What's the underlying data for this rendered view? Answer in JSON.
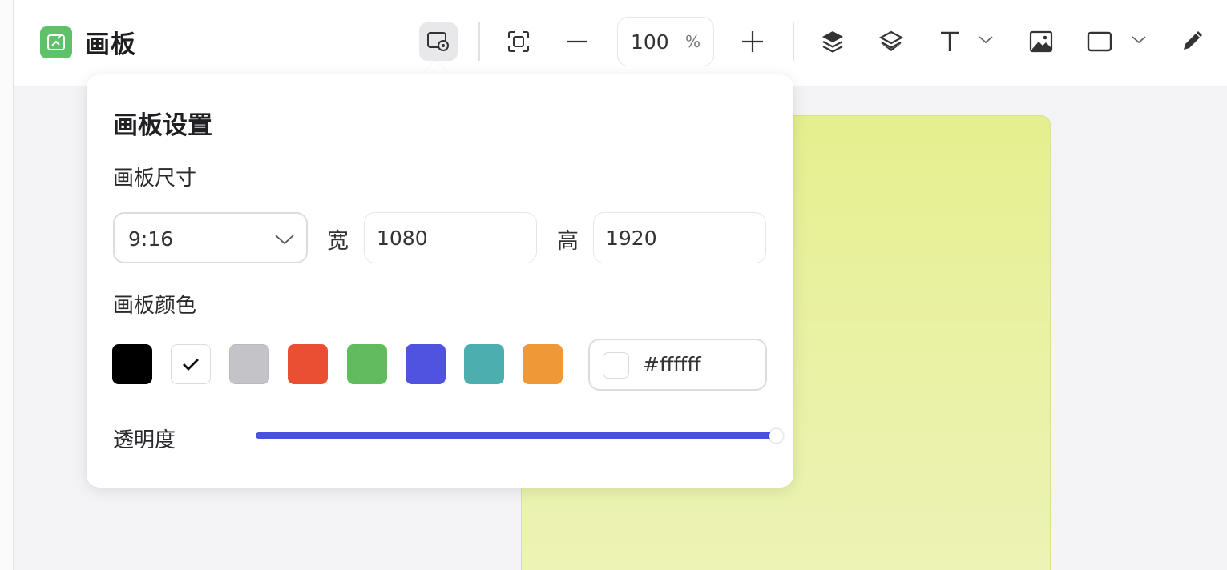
{
  "app": {
    "title": "画板",
    "logo_color": "#5fc16a",
    "logo_icon": "whiteboard-icon"
  },
  "toolbar": {
    "tools": [
      {
        "name": "artboard-settings",
        "icon": "artboard-settings-icon",
        "active": true
      },
      {
        "name": "fit-screen",
        "icon": "fit-screen-icon"
      },
      {
        "name": "zoom-out",
        "icon": "minus-icon"
      },
      {
        "name": "zoom-in",
        "icon": "plus-icon"
      },
      {
        "name": "bring-forward",
        "icon": "layer-up-icon"
      },
      {
        "name": "send-backward",
        "icon": "layer-down-icon"
      },
      {
        "name": "text",
        "icon": "text-icon",
        "has_dropdown": true
      },
      {
        "name": "image",
        "icon": "image-icon"
      },
      {
        "name": "shape",
        "icon": "rectangle-icon",
        "has_dropdown": true
      },
      {
        "name": "pen",
        "icon": "pen-icon"
      }
    ],
    "zoom": {
      "value": "100",
      "unit": "%"
    }
  },
  "canvas": {
    "artboard_color": "#e8f09a"
  },
  "popover": {
    "title": "画板设置",
    "size_section": {
      "label": "画板尺寸",
      "ratio_value": "9:16",
      "width_label": "宽",
      "width_value": "1080",
      "height_label": "高",
      "height_value": "1920"
    },
    "color_section": {
      "label": "画板颜色",
      "swatches": [
        {
          "name": "black",
          "color": "#000000"
        },
        {
          "name": "white",
          "color": "#ffffff",
          "selected": true
        },
        {
          "name": "gray",
          "color": "#c3c3c8"
        },
        {
          "name": "red",
          "color": "#e94f30"
        },
        {
          "name": "green",
          "color": "#62bc5e"
        },
        {
          "name": "blue",
          "color": "#5053e0"
        },
        {
          "name": "teal",
          "color": "#4daeb0"
        },
        {
          "name": "orange",
          "color": "#ef9838"
        }
      ],
      "hex_value": "#ffffff"
    },
    "opacity": {
      "label": "透明度",
      "value": 1.0,
      "color": "#4a50e0"
    }
  }
}
